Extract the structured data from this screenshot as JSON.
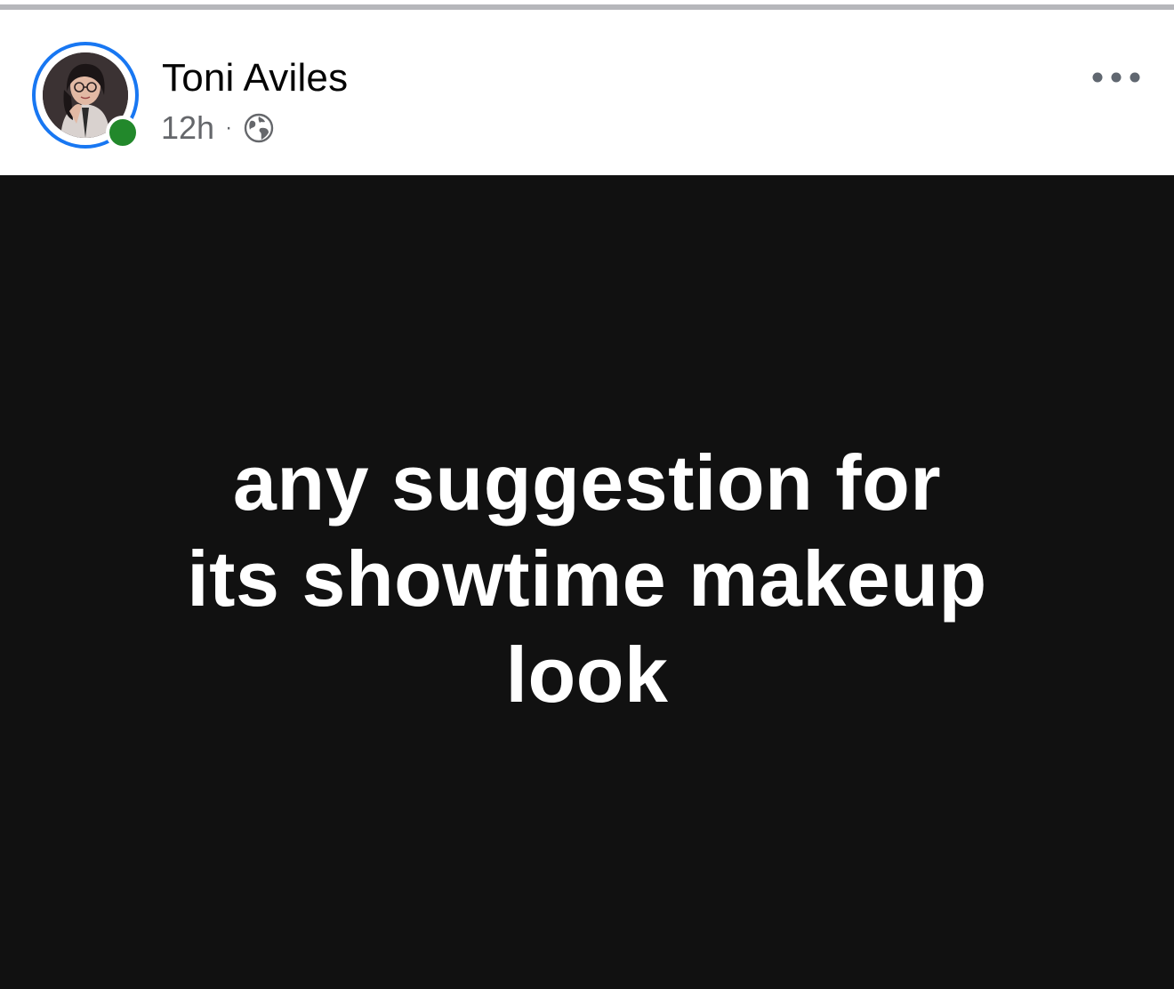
{
  "post": {
    "author": "Toni Aviles",
    "time": "12h",
    "separator": "·",
    "audience_icon": "globe-icon",
    "menu_icon": "more-options-icon",
    "text_lines": [
      "any suggestion for",
      "its showtime makeup",
      "look"
    ],
    "background_color": "#111111",
    "text_color": "#ffffff"
  },
  "colors": {
    "story_ring": "#1877f2",
    "online_status": "#22882b",
    "meta_text": "#65676b"
  }
}
